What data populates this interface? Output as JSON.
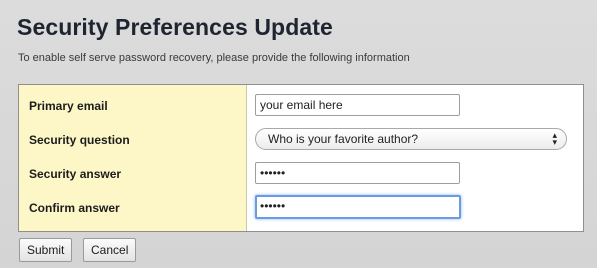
{
  "header": {
    "title": "Security Preferences Update",
    "subtitle": "To enable self serve password recovery, please provide the following information"
  },
  "form": {
    "primary_email": {
      "label": "Primary email",
      "value": "your email here"
    },
    "security_question": {
      "label": "Security question",
      "selected": "Who is your favorite author?"
    },
    "security_answer": {
      "label": "Security answer",
      "value": "••••••"
    },
    "confirm_answer": {
      "label": "Confirm answer",
      "value": "••••••"
    }
  },
  "actions": {
    "submit_label": "Submit",
    "cancel_label": "Cancel"
  },
  "colors": {
    "label_column_bg": "#fdf7c8",
    "page_bg": "#d8d8d8",
    "focus_ring": "#6b9be0"
  }
}
